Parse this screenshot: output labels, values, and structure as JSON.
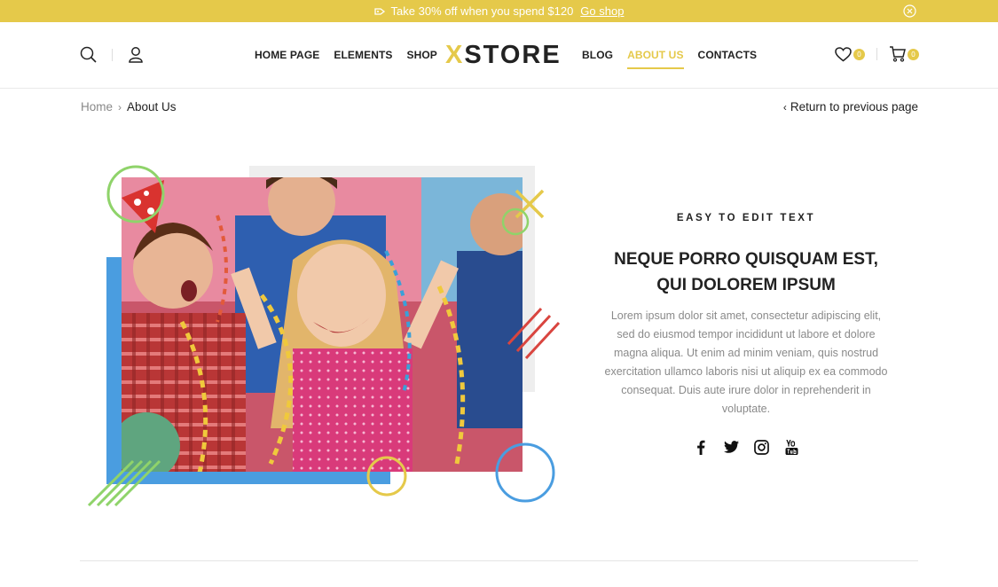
{
  "promo": {
    "text": "Take 30% off when you spend $120",
    "link": "Go shop",
    "icon": "tag-icon",
    "close_icon": "close-circle-icon"
  },
  "header": {
    "icons_left": [
      "search-icon",
      "user-icon"
    ],
    "nav_left": [
      "HOME PAGE",
      "ELEMENTS",
      "SHOP"
    ],
    "logo_x": "X",
    "logo_rest": "STORE",
    "nav_right": [
      "BLOG",
      "ABOUT US",
      "CONTACTS"
    ],
    "active_nav": "ABOUT US",
    "wishlist_count": "0",
    "cart_count": "0",
    "icons_right": [
      "heart-icon",
      "cart-icon"
    ]
  },
  "breadcrumb": {
    "home": "Home",
    "current": "About Us",
    "return": "Return to previous page"
  },
  "content": {
    "eyebrow": "EASY TO EDIT TEXT",
    "heading_line1": "NEQUE PORRO QUISQUAM EST,",
    "heading_line2": "QUI DOLOREM IPSUM",
    "body": "Lorem ipsum dolor sit amet, consectetur adipiscing elit, sed do eiusmod tempor incididunt ut labore et dolore magna aliqua. Ut enim ad minim veniam, quis nostrud exercitation ullamco laboris nisi ut aliquip ex ea commodo consequat. Duis aute irure dolor in reprehenderit in voluptate.",
    "socials": [
      "facebook-icon",
      "twitter-icon",
      "instagram-icon",
      "youtube-icon"
    ]
  },
  "colors": {
    "accent": "#e5c94a",
    "blue": "#4a9de0",
    "green": "#8fd36a",
    "red": "#d9453f"
  }
}
